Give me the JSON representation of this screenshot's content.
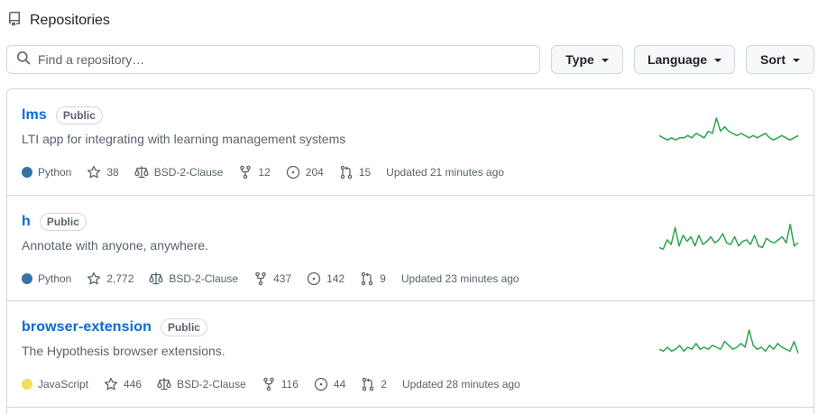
{
  "header": {
    "title": "Repositories",
    "icon": "repo-icon"
  },
  "search": {
    "placeholder": "Find a repository…",
    "value": ""
  },
  "filters": {
    "type_label": "Type",
    "language_label": "Language",
    "sort_label": "Sort"
  },
  "repos": [
    {
      "name": "lms",
      "visibility": "Public",
      "description": "LTI app for integrating with learning management systems",
      "language": "Python",
      "language_color": "#3572A5",
      "stars": "38",
      "license": "BSD-2-Clause",
      "forks": "12",
      "issues": "204",
      "pulls": "15",
      "updated": "Updated 21 minutes ago",
      "activity": [
        6,
        5,
        4,
        5,
        4,
        5,
        5,
        6,
        5,
        7,
        6,
        5,
        8,
        7,
        14,
        8,
        10,
        8,
        7,
        6,
        7,
        6,
        5,
        6,
        5,
        6,
        7,
        5,
        4,
        5,
        6,
        5,
        4,
        5,
        6
      ]
    },
    {
      "name": "h",
      "visibility": "Public",
      "description": "Annotate with anyone, anywhere.",
      "language": "Python",
      "language_color": "#3572A5",
      "stars": "2,772",
      "license": "BSD-2-Clause",
      "forks": "437",
      "issues": "142",
      "pulls": "9",
      "updated": "Updated 23 minutes ago",
      "activity": [
        5,
        4,
        10,
        7,
        18,
        6,
        13,
        9,
        12,
        6,
        13,
        7,
        9,
        12,
        8,
        10,
        14,
        8,
        7,
        12,
        6,
        9,
        10,
        7,
        13,
        6,
        5,
        11,
        9,
        8,
        10,
        12,
        8,
        20,
        6,
        8
      ]
    },
    {
      "name": "browser-extension",
      "visibility": "Public",
      "description": "The Hypothesis browser extensions.",
      "language": "JavaScript",
      "language_color": "#f1e05a",
      "stars": "446",
      "license": "BSD-2-Clause",
      "forks": "116",
      "issues": "44",
      "pulls": "2",
      "updated": "Updated 28 minutes ago",
      "activity": [
        6,
        5,
        7,
        5,
        6,
        8,
        5,
        7,
        6,
        9,
        6,
        7,
        6,
        8,
        7,
        6,
        10,
        8,
        6,
        7,
        9,
        7,
        16,
        8,
        6,
        7,
        5,
        8,
        6,
        9,
        7,
        6,
        5,
        10,
        4
      ]
    }
  ],
  "colors": {
    "link": "#0969da",
    "muted": "#59636e",
    "border": "#d0d7de",
    "sparkline": "#2da44e"
  }
}
